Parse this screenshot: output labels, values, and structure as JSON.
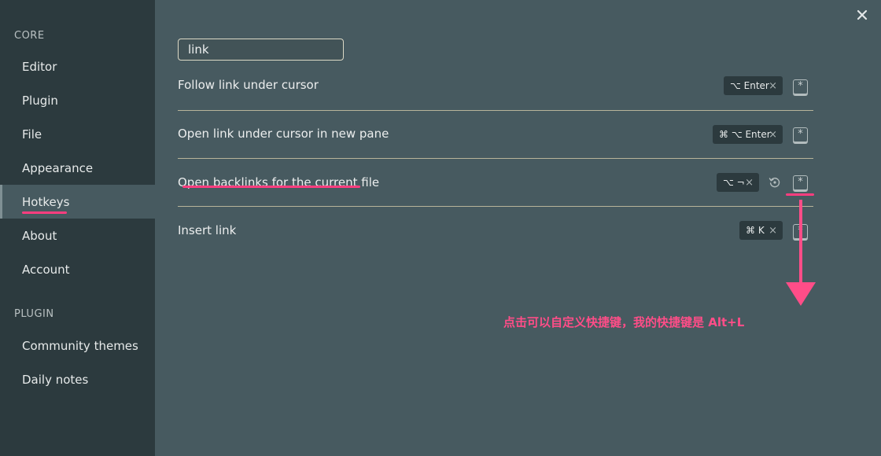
{
  "sidebar": {
    "sections": [
      {
        "label": "CORE",
        "items": [
          "Editor",
          "Plugin",
          "File",
          "Appearance",
          "Hotkeys",
          "About",
          "Account"
        ]
      },
      {
        "label": "PLUGIN",
        "items": [
          "Community themes",
          "Daily notes"
        ]
      }
    ],
    "active_item": "Hotkeys"
  },
  "close_icon": "close-icon",
  "search": {
    "value": "link",
    "placeholder": ""
  },
  "hotkeys": [
    {
      "label": "Follow link under cursor",
      "hotkey": "⌥ Enter",
      "has_restore": false
    },
    {
      "label": "Open link under cursor in new pane",
      "hotkey": "⌘ ⌥ Enter",
      "has_restore": false
    },
    {
      "label": "Open backlinks for the current file",
      "hotkey": "⌥ ¬",
      "has_restore": true
    },
    {
      "label": "Insert link",
      "hotkey": "⌘ K",
      "has_restore": false
    }
  ],
  "remove_glyph": "×",
  "add_hotkey_glyph": "*",
  "annotation": {
    "text": "点击可以自定义快捷键，我的快捷键是 Alt+L",
    "color": "#ff4d88"
  },
  "colors": {
    "background": "#475a60",
    "sidebar": "#2c3a3e",
    "chip": "#2c3a3e",
    "divider": "#b8b49a",
    "highlight": "#ff3d7f"
  }
}
